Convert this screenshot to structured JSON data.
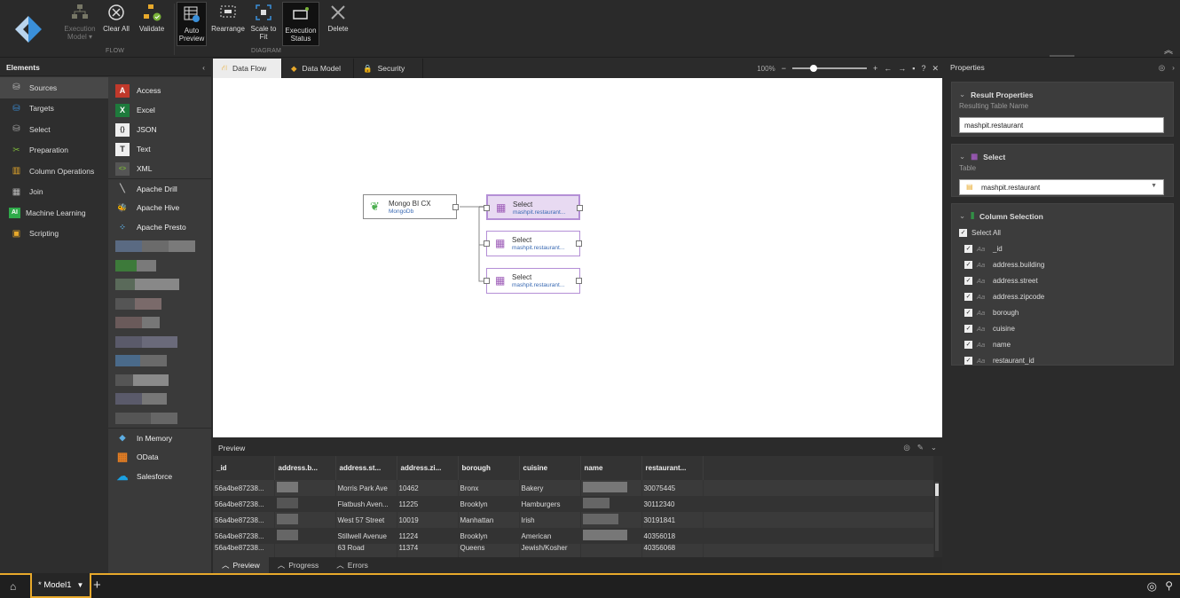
{
  "ribbon": {
    "flow_buttons": [
      {
        "label": "Execution Model ▾",
        "disabled": true
      },
      {
        "label": "Clear All"
      },
      {
        "label": "Validate"
      }
    ],
    "flow_group": "FLOW",
    "diagram_buttons": [
      {
        "label": "Auto Preview",
        "active": true
      },
      {
        "label": "Rearrange"
      },
      {
        "label": "Scale to Fit"
      },
      {
        "label": "Execution Status",
        "active": true
      },
      {
        "label": "Delete"
      }
    ],
    "diagram_group": "DIAGRAM"
  },
  "elements": {
    "title": "Elements",
    "categories": [
      {
        "label": "Sources",
        "selected": true
      },
      {
        "label": "Targets"
      },
      {
        "label": "Select"
      },
      {
        "label": "Preparation"
      },
      {
        "label": "Column Operations"
      },
      {
        "label": "Join"
      },
      {
        "label": "Machine Learning"
      },
      {
        "label": "Scripting"
      }
    ],
    "sources_top": [
      {
        "label": "Access",
        "icon": "A"
      },
      {
        "label": "Excel",
        "icon": "X"
      },
      {
        "label": "JSON",
        "icon": "{}"
      },
      {
        "label": "Text",
        "icon": "T"
      },
      {
        "label": "XML",
        "icon": "<>"
      }
    ],
    "sources_mid": [
      {
        "label": "Apache Drill"
      },
      {
        "label": "Apache Hive"
      },
      {
        "label": "Apache Presto"
      }
    ],
    "sources_bottom": [
      {
        "label": "In Memory"
      },
      {
        "label": "OData"
      },
      {
        "label": "Salesforce"
      }
    ]
  },
  "tabs": {
    "items": [
      {
        "label": "Data Flow",
        "selected": true
      },
      {
        "label": "Data Model"
      },
      {
        "label": "Security"
      }
    ],
    "zoom": "100%",
    "help": "?"
  },
  "canvas": {
    "source_node": {
      "title": "Mongo BI CX",
      "subtitle": "MongoDb"
    },
    "select_nodes": [
      {
        "title": "Select",
        "subtitle": "mashpit.restaurant..."
      },
      {
        "title": "Select",
        "subtitle": "mashpit.restaurant..."
      },
      {
        "title": "Select",
        "subtitle": "mashpit.restaurant..."
      }
    ]
  },
  "preview": {
    "title": "Preview",
    "columns": [
      "_id",
      "address.b...",
      "address.st...",
      "address.zi...",
      "borough",
      "cuisine",
      "name",
      "restaurant..."
    ],
    "rows": [
      [
        "56a4be87238...",
        "",
        "Morris Park Ave",
        "10462",
        "Bronx",
        "Bakery",
        "",
        "30075445"
      ],
      [
        "56a4be87238...",
        "",
        "Flatbush Aven...",
        "11225",
        "Brooklyn",
        "Hamburgers",
        "",
        "30112340"
      ],
      [
        "56a4be87238...",
        "",
        "West 57 Street",
        "10019",
        "Manhattan",
        "Irish",
        "",
        "30191841"
      ],
      [
        "56a4be87238...",
        "",
        "Stillwell Avenue",
        "11224",
        "Brooklyn",
        "American",
        "",
        "40356018"
      ],
      [
        "56a4be87238...",
        "",
        "63 Road",
        "11374",
        "Queens",
        "Jewish/Kosher",
        "",
        "40356068"
      ]
    ],
    "bottom_tabs": [
      {
        "label": "Preview",
        "selected": true
      },
      {
        "label": "Progress"
      },
      {
        "label": "Errors"
      }
    ]
  },
  "properties": {
    "title": "Properties",
    "result": {
      "title": "Result Properties",
      "label": "Resulting Table Name",
      "value": "mashpit.restaurant"
    },
    "select": {
      "title": "Select",
      "label": "Table",
      "value": "mashpit.restaurant"
    },
    "columns": {
      "title": "Column Selection",
      "select_all": "Select All",
      "aa": "Aa",
      "items": [
        "_id",
        "address.building",
        "address.street",
        "address.zipcode",
        "borough",
        "cuisine",
        "name",
        "restaurant_id"
      ]
    }
  },
  "status": {
    "model_tab": "* Model1",
    "add": "+"
  }
}
